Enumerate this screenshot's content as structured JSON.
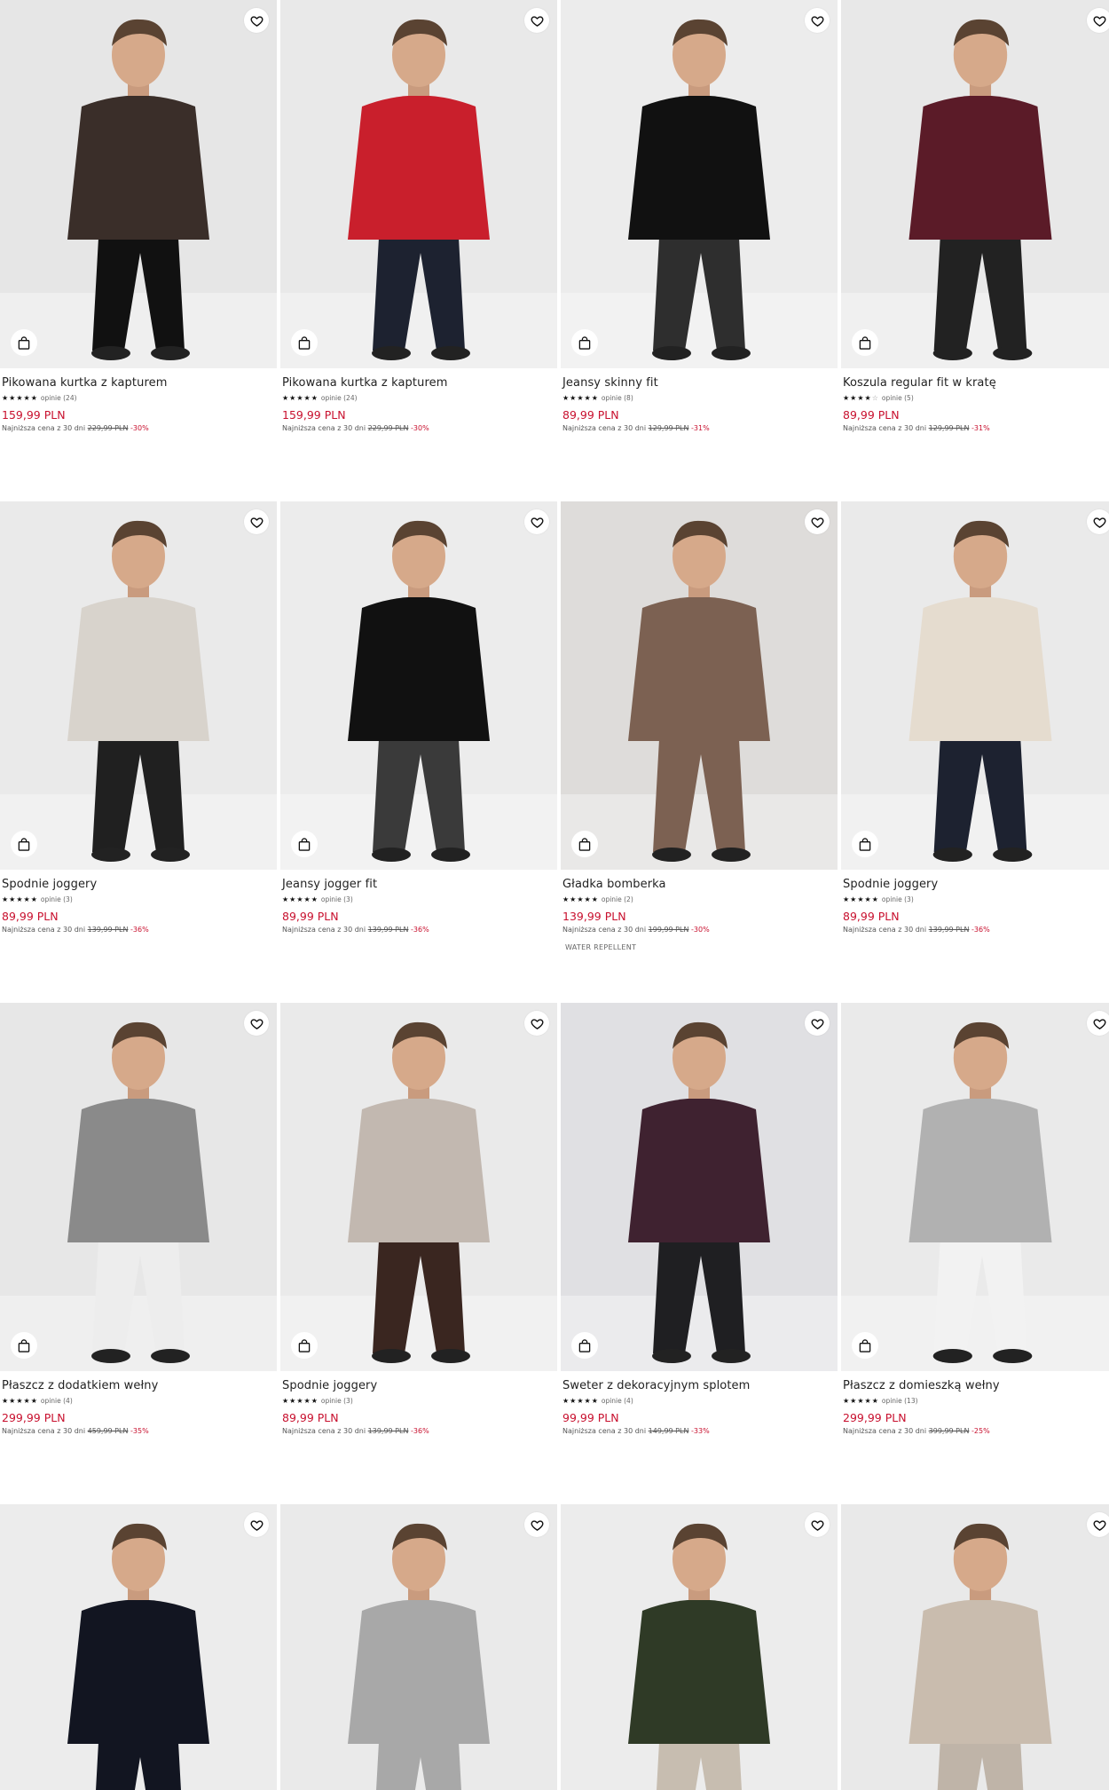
{
  "labels": {
    "lowest_price_prefix": "Najniższa cena z 30 dni",
    "reviews_prefix": "opinie"
  },
  "products": [
    {
      "name": "Pikowana kurtka z kapturem",
      "stars": 5,
      "reviews": "opinie (24)",
      "price": "159,99 PLN",
      "old_price": "229,99 PLN",
      "discount": "-30%",
      "bg": "#e6e6e6",
      "garment": "#3a2e29",
      "pants": "#111111"
    },
    {
      "name": "Pikowana kurtka z kapturem",
      "stars": 5,
      "reviews": "opinie (24)",
      "price": "159,99 PLN",
      "old_price": "229,99 PLN",
      "discount": "-30%",
      "bg": "#e9e9e9",
      "garment": "#c91f2c",
      "pants": "#1d2230"
    },
    {
      "name": "Jeansy skinny fit",
      "stars": 4.5,
      "reviews": "opinie (8)",
      "price": "89,99 PLN",
      "old_price": "129,99 PLN",
      "discount": "-31%",
      "bg": "#ececec",
      "garment": "#111111",
      "pants": "#2e2e2e"
    },
    {
      "name": "Koszula regular fit w kratę",
      "stars": 4,
      "reviews": "opinie (5)",
      "price": "89,99 PLN",
      "old_price": "129,99 PLN",
      "discount": "-31%",
      "bg": "#e8e8e8",
      "garment": "#5b1b28",
      "pants": "#222222"
    },
    {
      "name": "Spodnie joggery",
      "stars": 5,
      "reviews": "opinie (3)",
      "price": "89,99 PLN",
      "old_price": "139,99 PLN",
      "discount": "-36%",
      "bg": "#eaeaea",
      "garment": "#d8d3cc",
      "pants": "#202020"
    },
    {
      "name": "Jeansy jogger fit",
      "stars": 5,
      "reviews": "opinie (3)",
      "price": "89,99 PLN",
      "old_price": "139,99 PLN",
      "discount": "-36%",
      "bg": "#ececec",
      "garment": "#111111",
      "pants": "#3a3a3a"
    },
    {
      "name": "Gładka bomberka",
      "stars": 5,
      "reviews": "opinie (2)",
      "price": "139,99 PLN",
      "old_price": "199,99 PLN",
      "discount": "-30%",
      "bg": "#dedcda",
      "garment": "#7c6152",
      "pants": "#7c6152",
      "tag": "WATER REPELLENT"
    },
    {
      "name": "Spodnie joggery",
      "stars": 5,
      "reviews": "opinie (3)",
      "price": "89,99 PLN",
      "old_price": "139,99 PLN",
      "discount": "-36%",
      "bg": "#eaeaea",
      "garment": "#e5dccf",
      "pants": "#1d2230"
    },
    {
      "name": "Płaszcz z dodatkiem wełny",
      "stars": 5,
      "reviews": "opinie (4)",
      "price": "299,99 PLN",
      "old_price": "459,99 PLN",
      "discount": "-35%",
      "bg": "#e7e7e7",
      "garment": "#8a8a8a",
      "pants": "#ededed"
    },
    {
      "name": "Spodnie joggery",
      "stars": 5,
      "reviews": "opinie (3)",
      "price": "89,99 PLN",
      "old_price": "139,99 PLN",
      "discount": "-36%",
      "bg": "#eaeaea",
      "garment": "#c2b8b0",
      "pants": "#3a2620"
    },
    {
      "name": "Sweter z dekoracyjnym splotem",
      "stars": 5,
      "reviews": "opinie (4)",
      "price": "99,99 PLN",
      "old_price": "149,99 PLN",
      "discount": "-33%",
      "bg": "#e0e0e3",
      "garment": "#3f2230",
      "pants": "#1f1f22"
    },
    {
      "name": "Płaszcz z domieszką wełny",
      "stars": 5,
      "reviews": "opinie (13)",
      "price": "299,99 PLN",
      "old_price": "399,99 PLN",
      "discount": "-25%",
      "bg": "#eaeaea",
      "garment": "#b1b1b1",
      "pants": "#f2f2f2"
    },
    {
      "bg": "#ececec",
      "garment": "#121521",
      "pants": "#121521"
    },
    {
      "bg": "#eaeaea",
      "garment": "#a8a8a8",
      "pants": "#a8a8a8"
    },
    {
      "bg": "#ececec",
      "garment": "#2f3a26",
      "pants": "#c7bdb0"
    },
    {
      "bg": "#e9e9e9",
      "garment": "#c9bcae",
      "pants": "#bfb4a8"
    }
  ]
}
